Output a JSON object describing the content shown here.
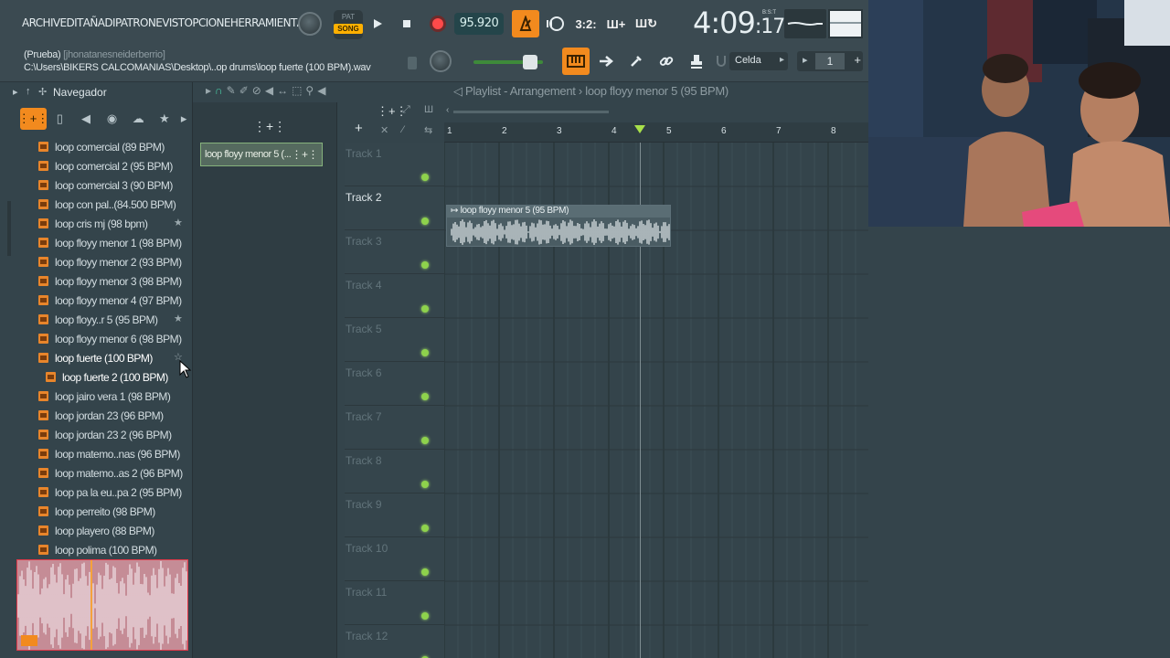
{
  "menu": [
    "ARCHIV",
    "EDIT",
    "AÑADI",
    "PATRON",
    "EVIST",
    "OPCIONE",
    "HERRAMIENT",
    "AY"
  ],
  "transport": {
    "pat_label": "PAT",
    "song_label": "SONG",
    "tempo": "95.920",
    "time": "4:09",
    "time_sub": ":17",
    "time_unit": "B:S:T"
  },
  "hint": {
    "line1": "(Prueba)",
    "line1_sub": "[jhonatanesneiderberrio]",
    "line2": "C:\\Users\\BIKERS CALCOMANIAS\\Desktop\\..op drums\\loop fuerte (100 BPM).wav"
  },
  "snap_label": "Celda",
  "pattern_number": "1",
  "accent_color": "#f28a1e",
  "browser": {
    "title": "Navegador",
    "files": [
      {
        "name": "loop comercial (89 BPM)",
        "star": false
      },
      {
        "name": "loop comercial 2 (95 BPM)",
        "star": false
      },
      {
        "name": "loop comercial 3 (90 BPM)",
        "star": false
      },
      {
        "name": "loop con pal..(84.500 BPM)",
        "star": false
      },
      {
        "name": "loop cris mj (98 bpm)",
        "star": true
      },
      {
        "name": "loop floyy menor 1 (98 BPM)",
        "star": false
      },
      {
        "name": "loop floyy menor 2 (93 BPM)",
        "star": false
      },
      {
        "name": "loop floyy menor 3 (98 BPM)",
        "star": false
      },
      {
        "name": "loop floyy menor 4 (97 BPM)",
        "star": false
      },
      {
        "name": "loop floyy..r 5 (95 BPM)",
        "star": true
      },
      {
        "name": "loop floyy menor 6 (98 BPM)",
        "star": false
      },
      {
        "name": "loop fuerte (100 BPM)",
        "star": true,
        "selected": true
      },
      {
        "name": "loop fuerte 2 (100 BPM)",
        "star": false,
        "sub": true
      },
      {
        "name": "loop jairo vera 1 (98 BPM)",
        "star": false
      },
      {
        "name": "loop jordan 23 (96 BPM)",
        "star": false
      },
      {
        "name": "loop jordan 23 2 (96 BPM)",
        "star": false
      },
      {
        "name": "loop matemo..nas (96 BPM)",
        "star": false
      },
      {
        "name": "loop matemo..as 2 (96 BPM)",
        "star": false
      },
      {
        "name": "loop pa la eu..pa 2 (95 BPM)",
        "star": false
      },
      {
        "name": "loop perreito (98 BPM)",
        "star": false
      },
      {
        "name": "loop playero (88 BPM)",
        "star": false
      },
      {
        "name": "loop polima (100 BPM)",
        "star": false
      }
    ]
  },
  "playlist": {
    "title": "Playlist - Arrangement",
    "separator": "›",
    "pattern_name": "loop floyy menor 5 (95 BPM)",
    "picker_clip": "loop floyy menor 5 (...",
    "clip_title": "loop floyy menor 5 (95 BPM)",
    "bars": [
      "1",
      "2",
      "3",
      "4",
      "5",
      "6",
      "7",
      "8"
    ],
    "tracks": [
      "Track 1",
      "Track 2",
      "Track 3",
      "Track 4",
      "Track 5",
      "Track 6",
      "Track 7",
      "Track 8",
      "Track 9",
      "Track 10",
      "Track 11",
      "Track 12"
    ],
    "active_track": "Track 2"
  }
}
